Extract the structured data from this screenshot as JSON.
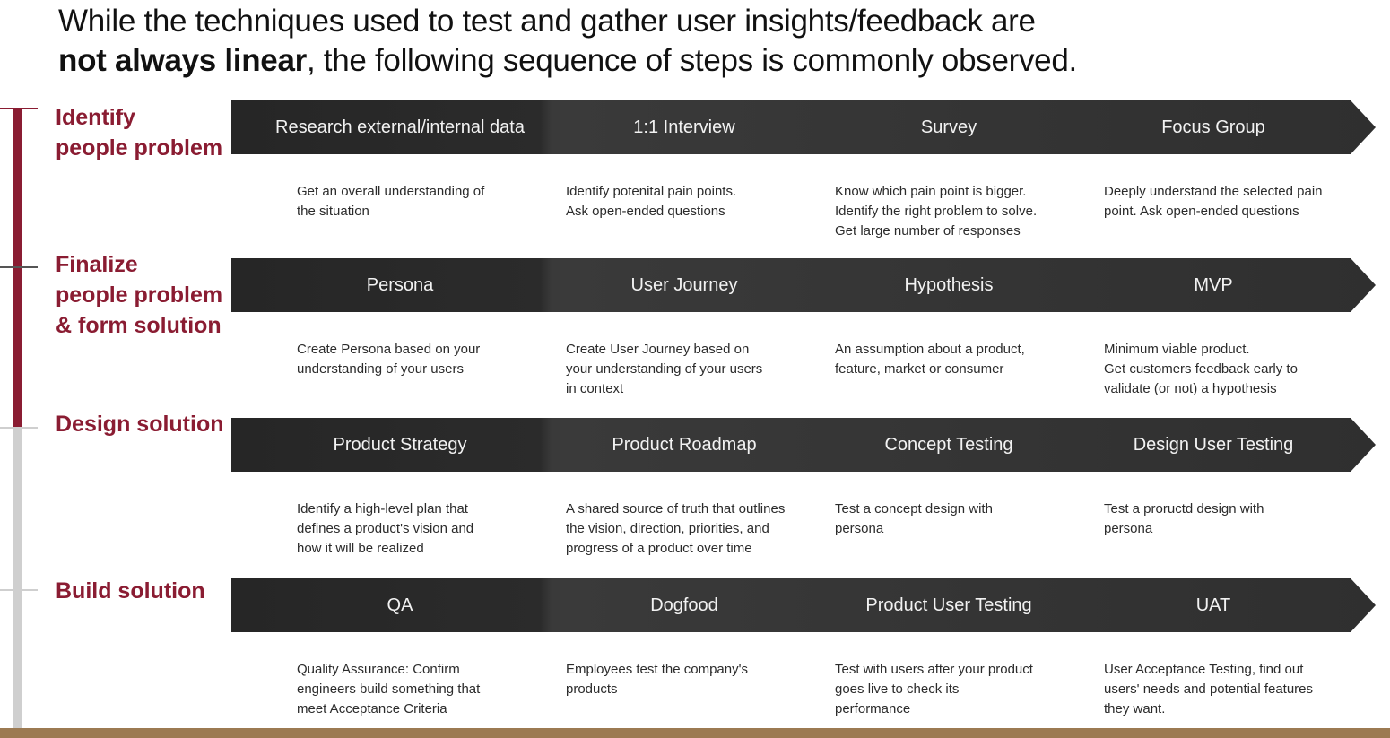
{
  "header": {
    "line1": "While the techniques used to test and gather user insights/feedback are",
    "line2_bold": "not always linear",
    "line2_rest": ", the following sequence of steps is commonly observed."
  },
  "colors": {
    "accent": "#8a1c32",
    "band": "#2e2e2e",
    "timeline_grey": "#cfcfcf",
    "footer": "#9c7a52"
  },
  "stages": [
    {
      "lines": [
        "Identify",
        "people problem"
      ]
    },
    {
      "lines": [
        "Finalize",
        "people problem",
        "& form solution"
      ]
    },
    {
      "lines": [
        "Design solution"
      ]
    },
    {
      "lines": [
        "Build solution"
      ]
    }
  ],
  "rows": [
    {
      "steps": [
        "Research external/internal data",
        "1:1 Interview",
        "Survey",
        "Focus Group"
      ],
      "descriptions": [
        [
          "Get an overall understanding of",
          "the situation"
        ],
        [
          "Identify potenital pain points.",
          "Ask open-ended questions"
        ],
        [
          "Know which pain point is bigger.",
          "Identify the right problem to solve.",
          "Get large number of responses"
        ],
        [
          "Deeply understand the selected pain",
          "point. Ask open-ended questions"
        ]
      ]
    },
    {
      "steps": [
        "Persona",
        "User Journey",
        "Hypothesis",
        "MVP"
      ],
      "descriptions": [
        [
          "Create Persona based on your",
          "understanding of  your users"
        ],
        [
          "Create User Journey based on",
          "your understanding of your users",
          "in context"
        ],
        [
          "An assumption about a product,",
          "feature, market or consumer"
        ],
        [
          "Minimum viable product.",
          "Get customers feedback early to",
          "validate (or not) a hypothesis"
        ]
      ]
    },
    {
      "steps": [
        "Product Strategy",
        "Product Roadmap",
        "Concept Testing",
        "Design User Testing"
      ],
      "descriptions": [
        [
          "Identify a high-level plan that",
          "defines a product's vision and",
          "how it will be realized"
        ],
        [
          "A shared source of truth that outlines",
          "the vision, direction, priorities, and",
          "progress of a product over time"
        ],
        [
          "Test a concept design with",
          "persona"
        ],
        [
          "Test a proructd design with",
          "persona"
        ]
      ]
    },
    {
      "steps": [
        "QA",
        "Dogfood",
        "Product User Testing",
        "UAT"
      ],
      "descriptions": [
        [
          "Quality Assurance: Confirm",
          "engineers build something that",
          "meet Acceptance Criteria"
        ],
        [
          "Employees test the company's",
          "products"
        ],
        [
          "Test with users after your product",
          "goes live to check its",
          "performance"
        ],
        [
          "User Acceptance Testing, find out",
          "users' needs and potential features",
          "they want."
        ]
      ]
    }
  ]
}
